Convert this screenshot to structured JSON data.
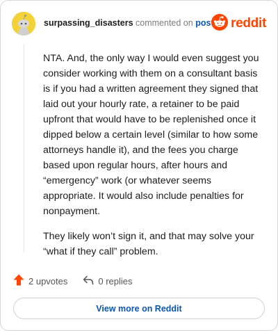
{
  "comment": {
    "username": "surpassing_disasters",
    "action_text": "commented on",
    "post_link": "post",
    "paragraphs": [
      "NTA. And, the only way I would even suggest you consider working with them on a consultant basis is if you had a written agreement they signed that laid out your hourly rate, a retainer to be paid upfront that would have to be replenished once it dipped below a certain level (similar to how some attorneys handle it), and the fees you charge based upon regular hours, after hours and “emergency” work (or whatever seems appropriate. It would also include penalties for nonpayment.",
      "They likely won’t sign it, and that may solve your “what if they call” problem."
    ]
  },
  "brand": {
    "wordmark": "reddit",
    "color": "#ff4500"
  },
  "actions": {
    "upvotes": "2 upvotes",
    "replies": "0 replies",
    "upvote_color": "#ff4500"
  },
  "footer": {
    "view_more": "View more on Reddit"
  },
  "icons": {
    "avatar": "snoo-avatar-icon",
    "logo": "reddit-logo-icon",
    "upvote": "upvote-arrow-icon",
    "reply": "reply-arrow-icon"
  }
}
